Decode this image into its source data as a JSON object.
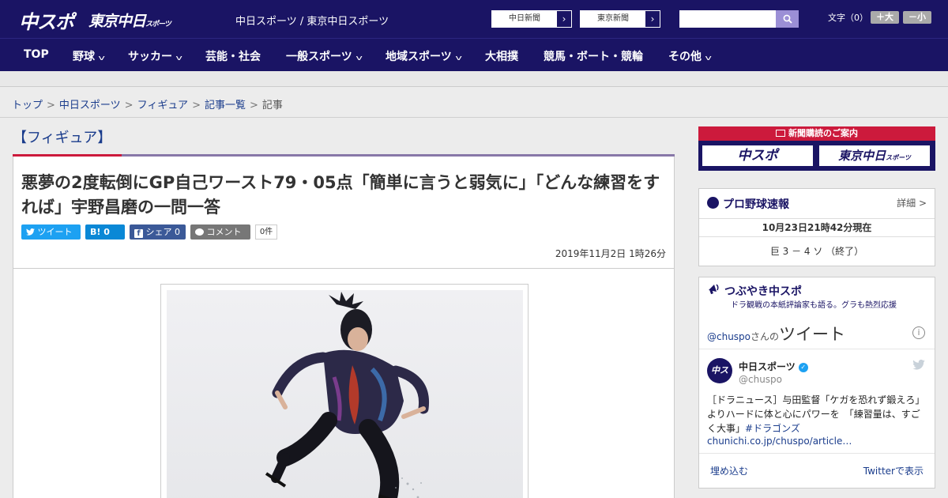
{
  "header": {
    "logo_chuspo": "中スポ",
    "logo_tokyo": "東京中日",
    "logo_tokyo_sub": "スポーツ",
    "site_links": "中日スポーツ / 東京中日スポーツ",
    "newspaper_links": [
      {
        "label": "中日新聞",
        "arrow": "›"
      },
      {
        "label": "東京新聞",
        "arrow": "›"
      }
    ],
    "search_placeholder": "",
    "font_size_label": "文字（0）",
    "font_bigger": "＋大",
    "font_smaller": "－小"
  },
  "nav": {
    "items": [
      {
        "label": "TOP",
        "chevron": false
      },
      {
        "label": "野球",
        "chevron": true
      },
      {
        "label": "サッカー",
        "chevron": true
      },
      {
        "label": "芸能・社会",
        "chevron": false
      },
      {
        "label": "一般スポーツ",
        "chevron": true
      },
      {
        "label": "地域スポーツ",
        "chevron": true
      },
      {
        "label": "大相撲",
        "chevron": false
      },
      {
        "label": "競馬・ボート・競輪",
        "chevron": false
      },
      {
        "label": "その他",
        "chevron": true
      }
    ],
    "chevron_glyph": "v"
  },
  "breadcrumb": {
    "items": [
      "トップ",
      "中日スポーツ",
      "フィギュア",
      "記事一覧",
      "記事"
    ],
    "separator": ">"
  },
  "article": {
    "category": "【フィギュア】",
    "headline": "悪夢の2度転倒にGP自己ワースト79・05点「簡単に言うと弱気に」「どんな練習をすれば」宇野昌磨の一問一答",
    "share": {
      "tweet": "ツイート",
      "hatena_label": "B!",
      "hatena_count": "0",
      "facebook_label": "シェア",
      "facebook_count": "0",
      "comment": "コメント",
      "comment_count": "0件"
    },
    "date": "2019年11月2日 1時26分"
  },
  "sidebar": {
    "subscribe": {
      "header": "新聞購読のご案内",
      "logo1": "中スポ",
      "logo2": "東京中日",
      "logo2_sub": "スポーツ"
    },
    "baseball": {
      "title": "プロ野球速報",
      "detail": "詳細 >",
      "time": "10月23日21時42分現在",
      "score": "巨 3 － 4 ソ （終了）"
    },
    "tweets": {
      "title": "つぶやき中スポ",
      "subtitle": "ドラ観戦の本紙評論家も語る。グラも熱烈応援",
      "handle_prefix": "@chuspo",
      "handle_suffix": "さんの",
      "heading": "ツイート",
      "info": "i",
      "account_name": "中日スポーツ",
      "verified": "✓",
      "account_handle": "@chuspo",
      "avatar_text": "中スポ",
      "tweet_text": "［ドラニュース］与田監督「ケガを恐れず鍛えろ」　よりハードに体と心にパワーを　「練習量は、すごく大事」",
      "tweet_hashtag": "#ドラゴンズ",
      "tweet_link": "chunichi.co.jp/chuspo/article…",
      "embed": "埋め込む",
      "view_on_twitter": "Twitterで表示"
    }
  },
  "colors": {
    "brand_navy": "#1a1464",
    "accent_red": "#cc1a3c",
    "twitter_blue": "#1da1f2",
    "facebook_blue": "#3b5998",
    "hatena_blue": "#0a88d6"
  }
}
